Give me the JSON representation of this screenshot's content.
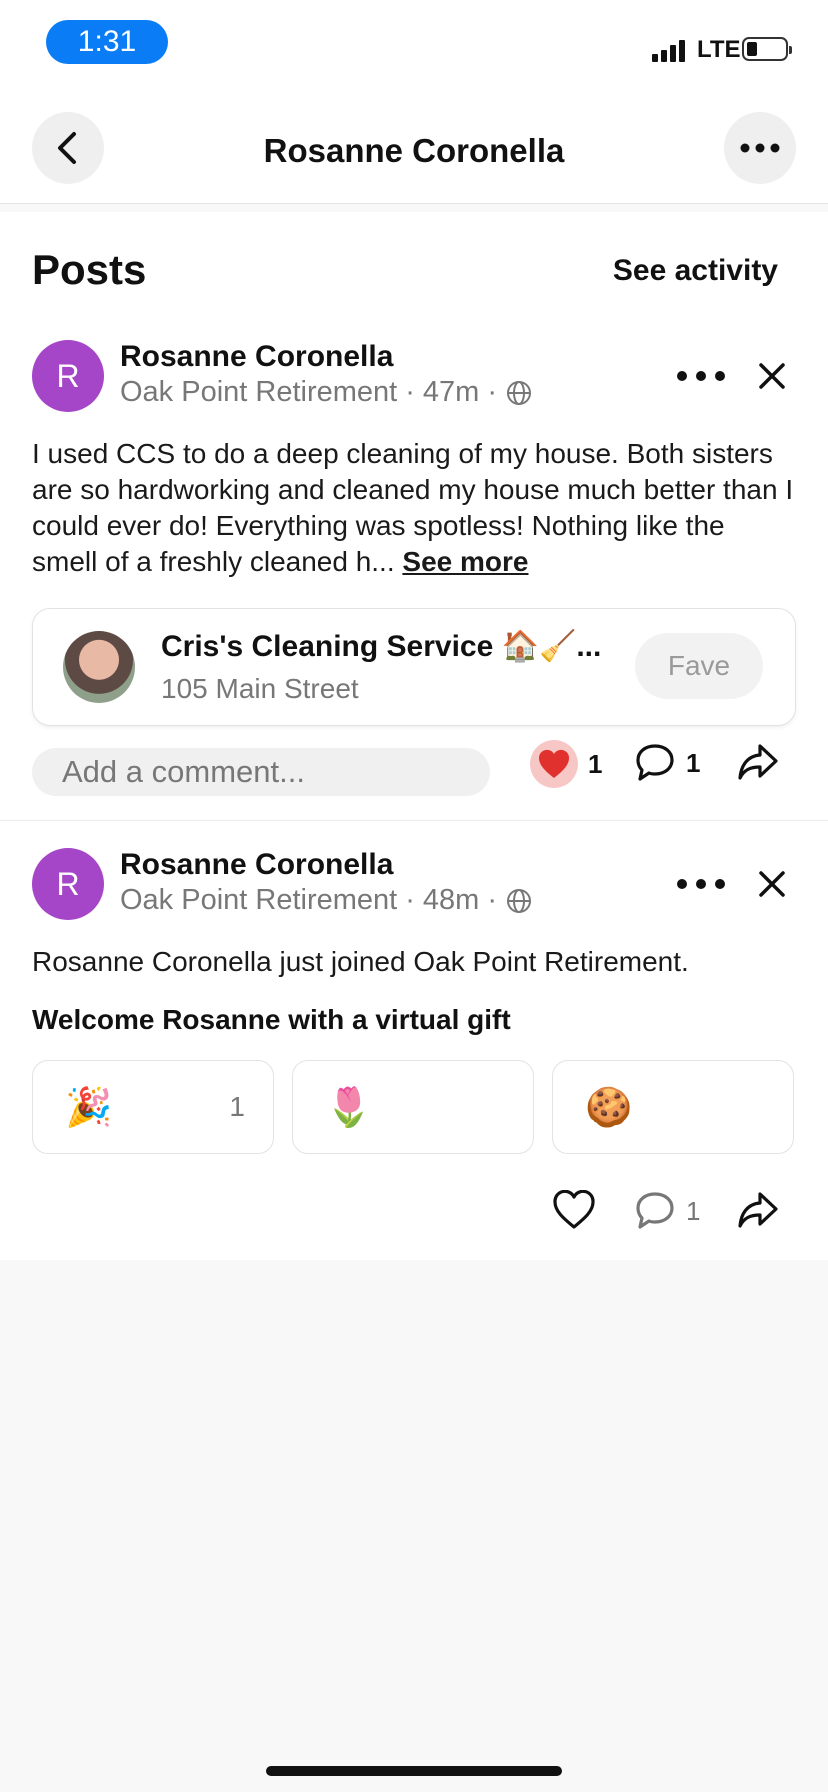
{
  "status_bar": {
    "time": "1:31",
    "network": "LTE"
  },
  "header": {
    "title": "Rosanne Coronella"
  },
  "feed": {
    "title": "Posts",
    "see_activity": "See activity"
  },
  "posts": [
    {
      "author": "Rosanne Coronella",
      "avatar_initial": "R",
      "community": "Oak Point Retirement",
      "time": "47m",
      "body": "I used CCS to do a deep cleaning of my house. Both sisters are so hardworking and cleaned my house much better than I could ever do!  Everything was spotless!  Nothing like the smell of a freshly cleaned h...",
      "see_more": "See more",
      "business": {
        "name": "Cris's Cleaning Service 🏠🧹...",
        "address": "105 Main Street",
        "fave_label": "Fave"
      },
      "comment_placeholder": "Add a comment...",
      "likes": "1",
      "comments": "1"
    },
    {
      "author": "Rosanne Coronella",
      "avatar_initial": "R",
      "community": "Oak Point Retirement",
      "time": "48m",
      "body": "Rosanne Coronella just joined Oak Point Retirement.",
      "gift_title": "Welcome Rosanne with a virtual gift",
      "gifts": [
        {
          "emoji": "🎉",
          "count": "1"
        },
        {
          "emoji": "🌷",
          "count": ""
        },
        {
          "emoji": "🍪",
          "count": ""
        }
      ],
      "comments": "1"
    }
  ],
  "colors": {
    "accent": "#0a7cf5",
    "avatar": "#a546c8",
    "heart": "#e0312f"
  }
}
